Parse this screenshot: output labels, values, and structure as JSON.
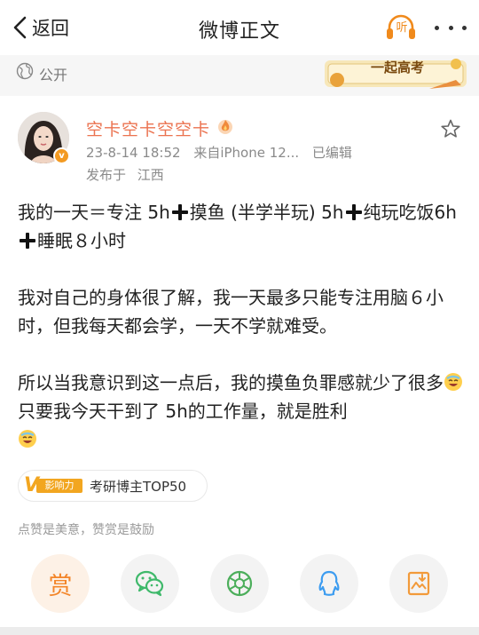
{
  "nav": {
    "back_label": "返回",
    "title": "微博正文",
    "listen_label": "听"
  },
  "visibility": {
    "label": "公开"
  },
  "banner": {
    "text": "一起高考"
  },
  "post": {
    "author": "空卡空卡空空卡",
    "date": "23-8-14 18:52",
    "source": "来自iPhone 12...",
    "edited": "已编辑",
    "location_prefix": "发布于",
    "location": "江西",
    "paragraphs": {
      "p1_a": "我的一天＝专注 5h",
      "p1_b": "摸鱼 (半学半玩) 5h",
      "p1_c": "纯玩吃饭6h",
      "p1_d": "睡眠８小时",
      "p2": "我对自己的身体很了解，我一天最多只能专注用脑６小时，但我每天都会学，一天不学就难受。",
      "p3_a": "所以当我意识到这一点后，我的摸鱼负罪感就少了很多",
      "p3_b": "只要我今天干到了 5h的工作量，就是胜利"
    }
  },
  "influence": {
    "logo_text": "影响力",
    "label": "考研博主TOP50"
  },
  "encourage_text": "点赞是美意，赞赏是鼓励",
  "actions": {
    "reward_label": "赏"
  },
  "colors": {
    "accent": "#eb7350",
    "listen": "#f08a1c",
    "reward": "#f3862a",
    "wechat": "#3fb96b",
    "moments": "#4cae5b",
    "qq": "#3c9cf0"
  }
}
